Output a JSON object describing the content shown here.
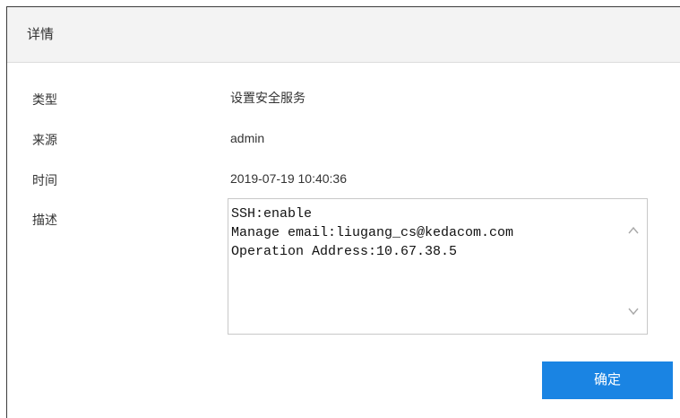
{
  "dialog": {
    "title": "详情"
  },
  "fields": {
    "type_label": "类型",
    "type_value": "设置安全服务",
    "source_label": "来源",
    "source_value": "admin",
    "time_label": "时间",
    "time_value": "2019-07-19 10:40:36",
    "description_label": "描述",
    "description_value": "SSH:enable\nManage email:liugang_cs@kedacom.com\nOperation Address:10.67.38.5"
  },
  "buttons": {
    "confirm_label": "确定"
  },
  "icons": {
    "scroll_up": "chevron-up-icon",
    "scroll_down": "chevron-down-icon"
  },
  "colors": {
    "accent": "#1a84e3",
    "header_bg": "#f3f3f3"
  }
}
